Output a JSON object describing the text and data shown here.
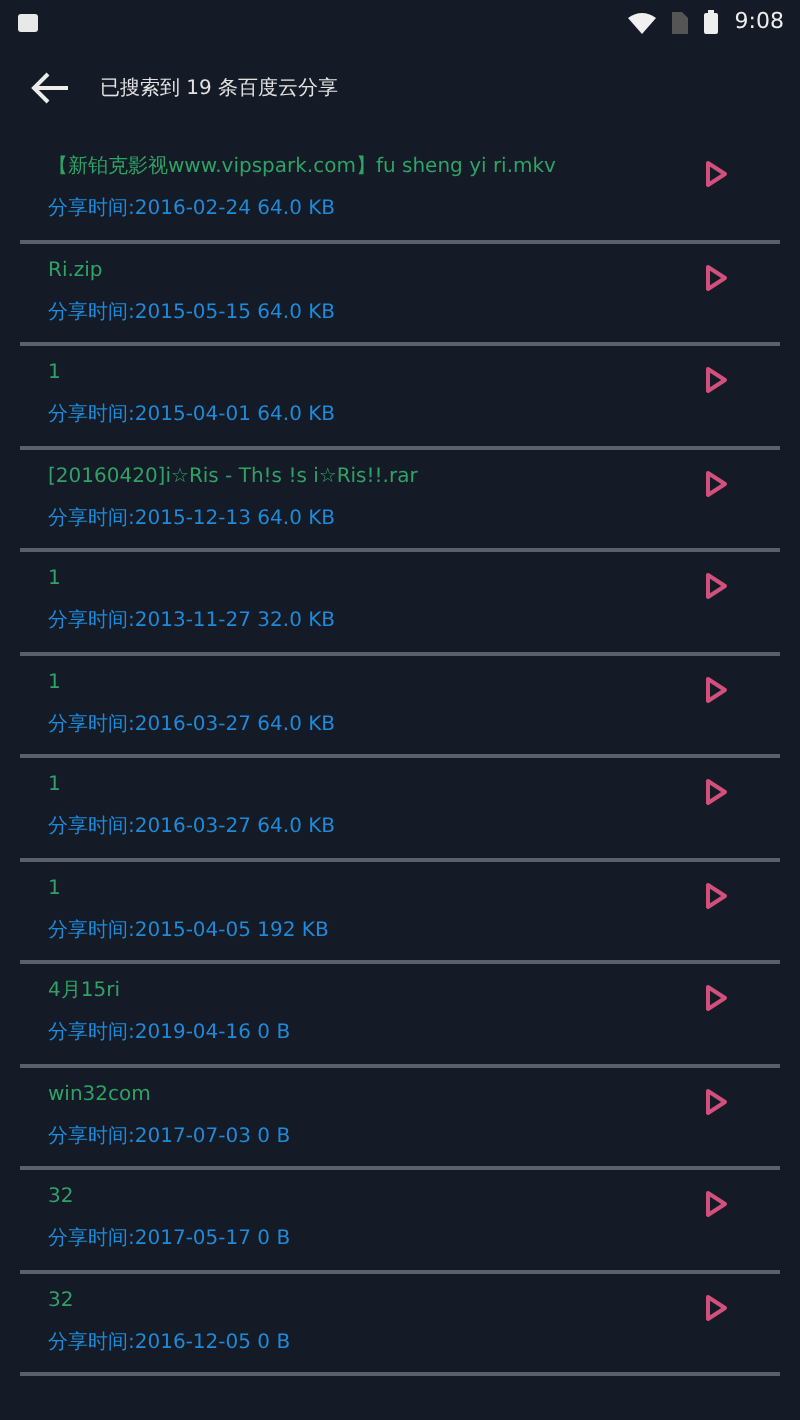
{
  "status_bar": {
    "time": "9:08"
  },
  "header": {
    "title": "已搜索到 19 条百度云分享"
  },
  "results": [
    {
      "name": "【新铂克影视www.vipspark.com】fu sheng yi ri.mkv",
      "meta": "分享时间:2016-02-24 64.0 KB"
    },
    {
      "name": "Ri.zip",
      "meta": "分享时间:2015-05-15 64.0 KB"
    },
    {
      "name": "1",
      "meta": "分享时间:2015-04-01 64.0 KB"
    },
    {
      "name": "[20160420]i☆Ris - Th!s !s i☆Ris!!.rar",
      "meta": "分享时间:2015-12-13 64.0 KB"
    },
    {
      "name": "1",
      "meta": "分享时间:2013-11-27 32.0 KB"
    },
    {
      "name": "1",
      "meta": "分享时间:2016-03-27 64.0 KB"
    },
    {
      "name": "1",
      "meta": "分享时间:2016-03-27 64.0 KB"
    },
    {
      "name": "1",
      "meta": "分享时间:2015-04-05 192 KB"
    },
    {
      "name": "4月15ri",
      "meta": "分享时间:2019-04-16 0 B"
    },
    {
      "name": "win32com",
      "meta": "分享时间:2017-07-03 0 B"
    },
    {
      "name": "32",
      "meta": "分享时间:2017-05-17 0 B"
    },
    {
      "name": "32",
      "meta": "分享时间:2016-12-05 0 B"
    }
  ]
}
